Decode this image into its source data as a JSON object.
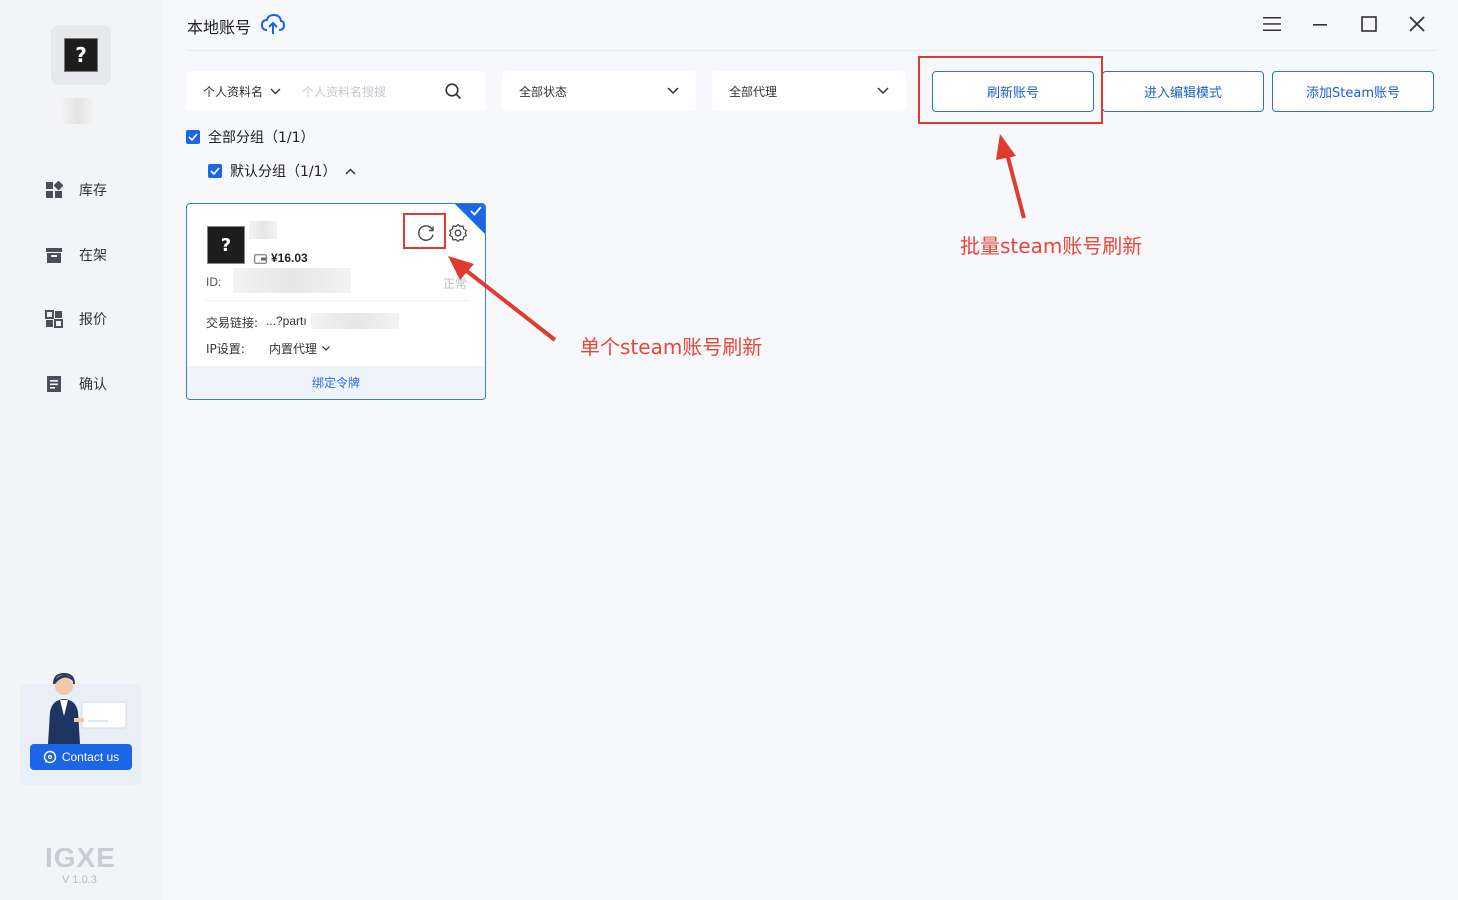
{
  "window": {
    "title": "本地账号"
  },
  "sidebar": {
    "nav": [
      {
        "label": "库存",
        "icon": "grid-icon"
      },
      {
        "label": "在架",
        "icon": "shelf-box-icon"
      },
      {
        "label": "报价",
        "icon": "quote-icon"
      },
      {
        "label": "确认",
        "icon": "checklist-icon"
      }
    ],
    "contact_label": "Contact us",
    "logo": "IGXE",
    "version": "V 1.0.3"
  },
  "filters": {
    "search_type": "个人资料名",
    "search_placeholder": "个人资料名搜搜",
    "status": "全部状态",
    "proxy": "全部代理"
  },
  "actions": {
    "refresh": "刷新账号",
    "edit_mode": "进入编辑模式",
    "add_steam": "添加Steam账号"
  },
  "groups": {
    "all": "全部分组（1/1）",
    "default": "默认分组（1/1）"
  },
  "account": {
    "balance": "¥16.03",
    "id_label": "ID:",
    "status": "正常",
    "trade_label": "交易链接:",
    "trade_value": "...?partı",
    "ip_label": "IP设置:",
    "ip_value": "内置代理",
    "bind_label": "绑定令牌"
  },
  "annotations": {
    "batch": "批量steam账号刷新",
    "single": "单个steam账号刷新"
  },
  "colors": {
    "accent": "#1a66e6",
    "annotation_red": "#e03b2f"
  }
}
